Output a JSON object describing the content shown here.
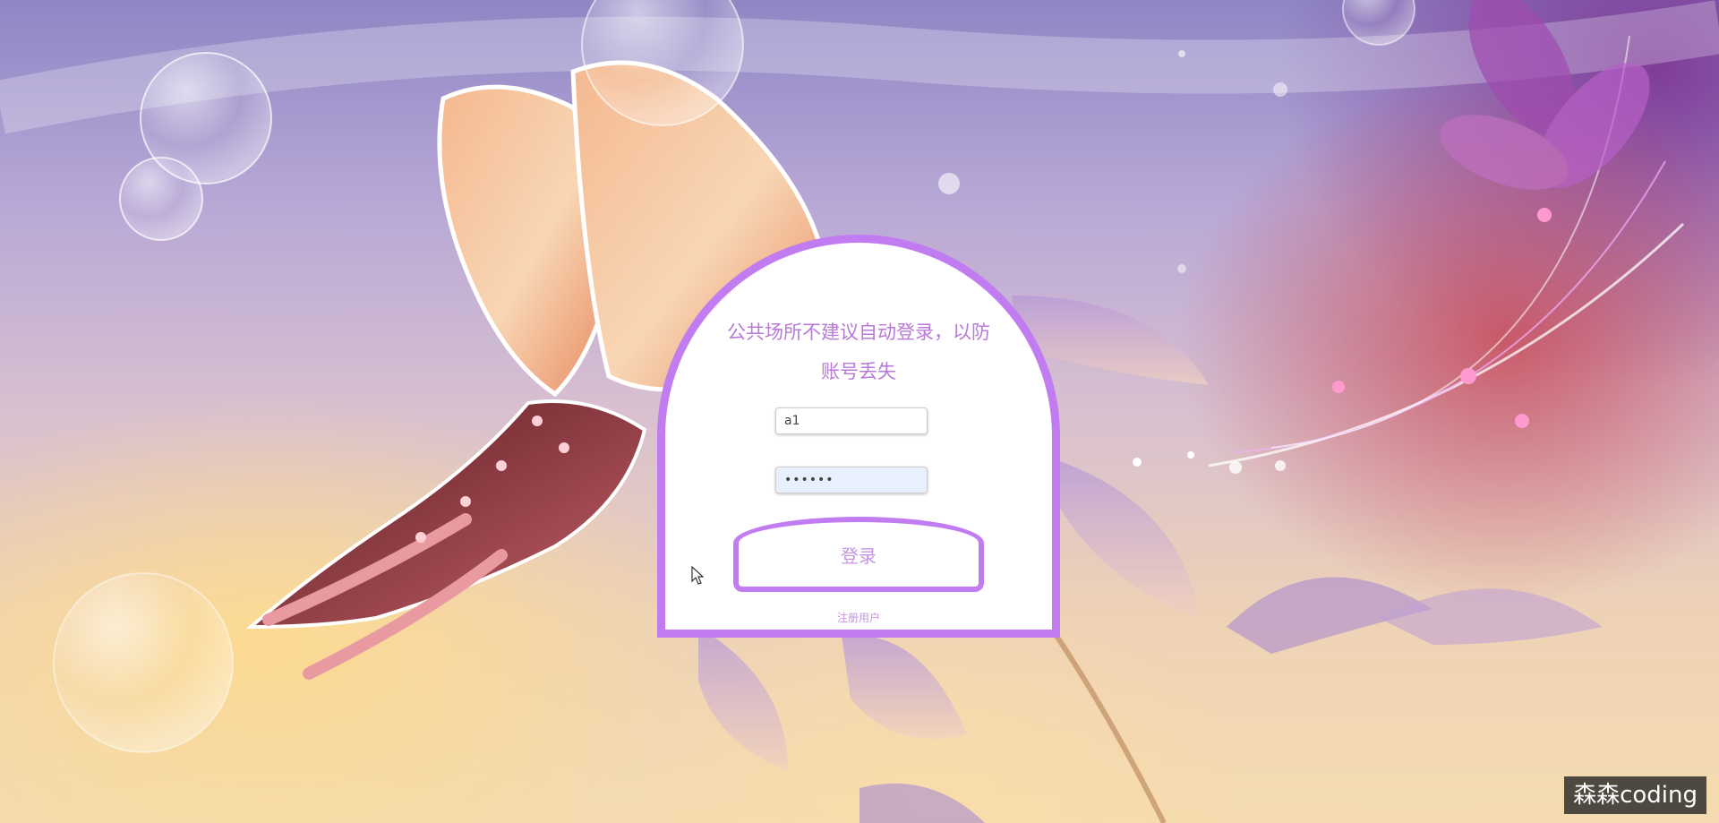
{
  "login_card": {
    "notice_text": "公共场所不建议自动登录，以防账号丢失",
    "username": {
      "value": "a1"
    },
    "password": {
      "value": "••••••"
    },
    "login_button_label": "登录",
    "register_link_label": "注册用户"
  },
  "watermark_text": "森森coding",
  "colors": {
    "card_border": "#c27cf2",
    "notice_text": "#b77ad6",
    "button_text": "#c694e2",
    "password_fill": "#e8f0fe"
  },
  "icons": [
    "butterfly-illustration",
    "lily-flower-illustration",
    "bubble-decoration",
    "pointer-cursor-icon"
  ]
}
